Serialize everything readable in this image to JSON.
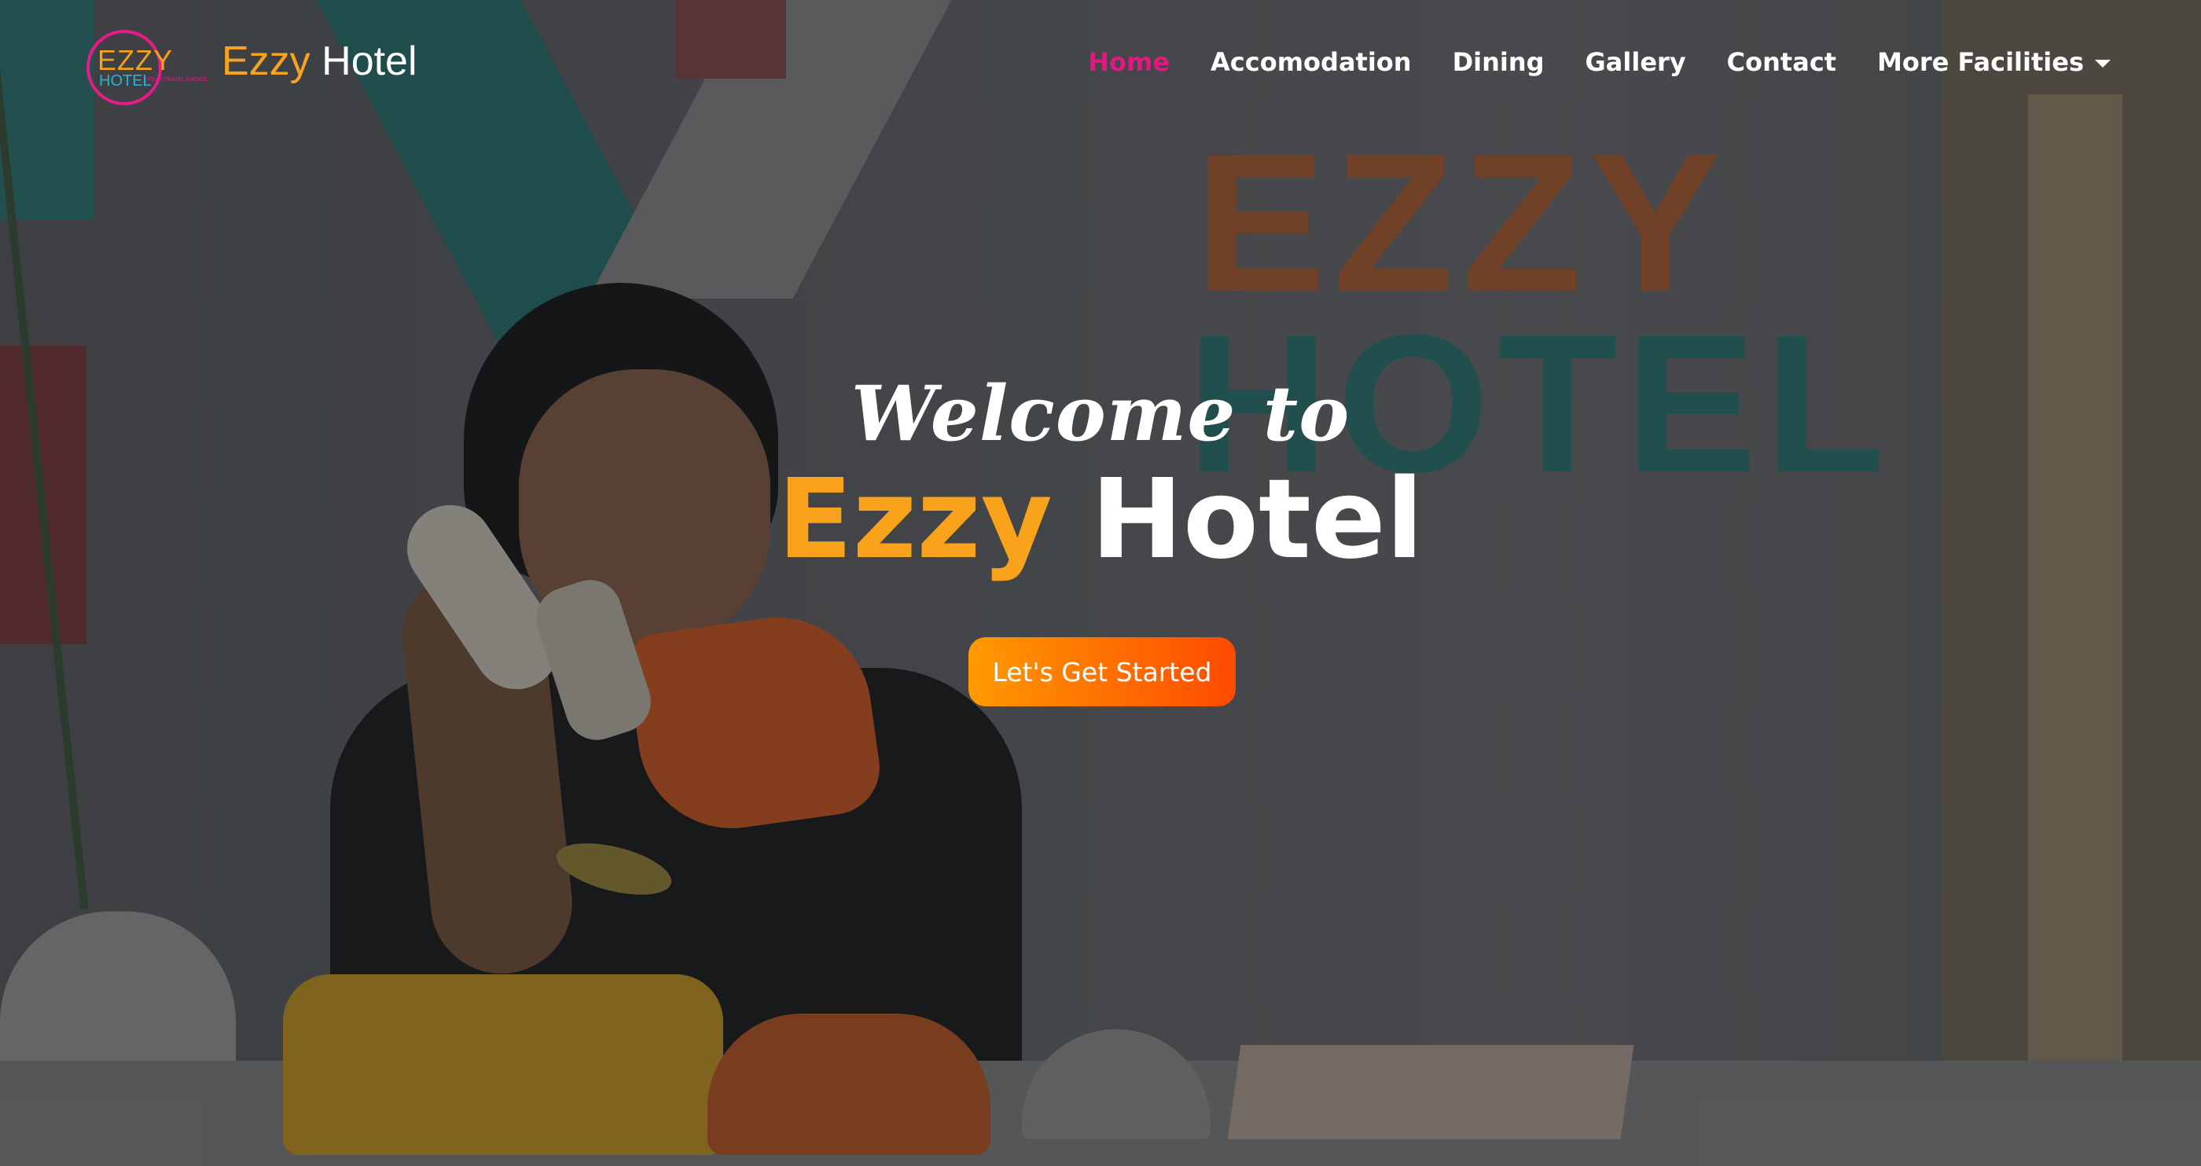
{
  "navbar": {
    "logo": {
      "line1": "EZZY",
      "line2": "HOTEL",
      "tagline": "YOUR TRAVEL CHOICE"
    },
    "brand": {
      "part1": "Ezzy",
      "part2": "Hotel"
    },
    "links": [
      {
        "label": "Home",
        "active": true
      },
      {
        "label": "Accomodation",
        "active": false
      },
      {
        "label": "Dining",
        "active": false
      },
      {
        "label": "Gallery",
        "active": false
      },
      {
        "label": "Contact",
        "active": false
      },
      {
        "label": "More Facilities",
        "active": false,
        "dropdown": true
      }
    ]
  },
  "hero": {
    "welcome": "Welcome to",
    "title_part1": "Ezzy",
    "title_part2": "Hotel",
    "cta_label": "Let's Get Started",
    "background_sign": {
      "line1": "EZZY",
      "line2": "HOTEL"
    }
  },
  "colors": {
    "accent_orange": "#f9a21b",
    "active_pink": "#e0197f",
    "cta_gradient_start": "#ff9a00",
    "cta_gradient_end": "#ff4a00"
  }
}
